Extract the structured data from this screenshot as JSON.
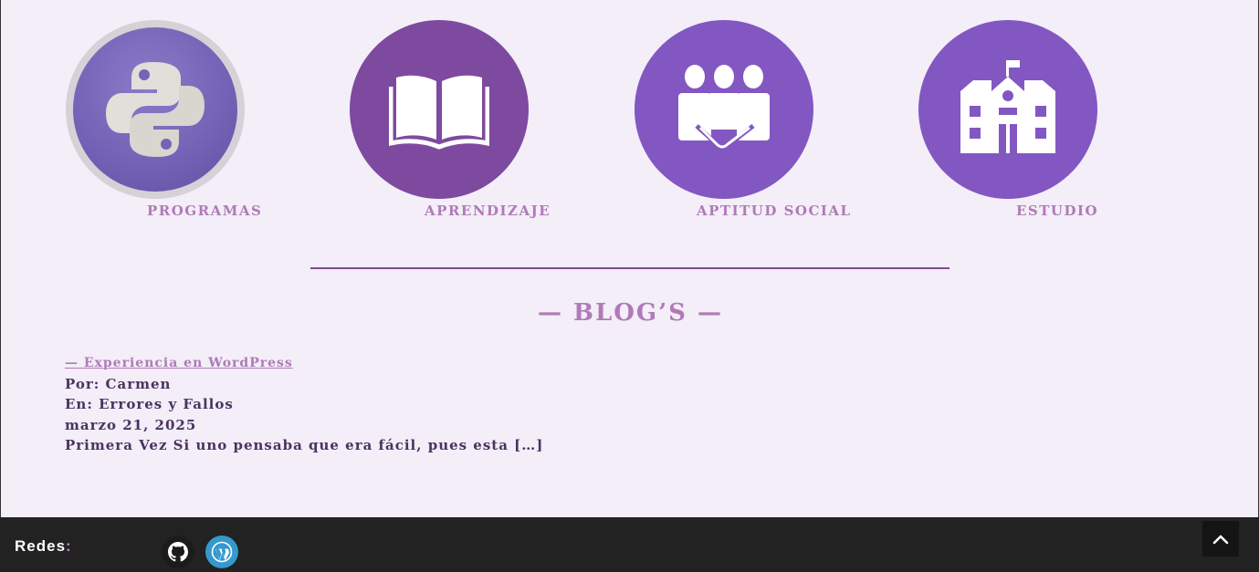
{
  "features": [
    {
      "label": "PROGRAMAS",
      "icon": "python-icon"
    },
    {
      "label": "APRENDIZAJE",
      "icon": "book-icon"
    },
    {
      "label": "APTITUD SOCIAL",
      "icon": "handshake-group-icon"
    },
    {
      "label": "ESTUDIO",
      "icon": "school-building-icon"
    }
  ],
  "blog": {
    "heading": "— BLOG’S —",
    "posts": [
      {
        "title": "— Experiencia en WordPress",
        "author": "Por: Carmen",
        "category": "En: Errores y Fallos",
        "date": "marzo 21, 2025",
        "excerpt": "Primera Vez Si uno pensaba que era fácil, pues esta […]"
      }
    ]
  },
  "footer": {
    "label": "Redes",
    "label_colon": ":",
    "social": [
      {
        "name": "github-icon",
        "color": "#1b1b1b"
      },
      {
        "name": "wordpress-icon",
        "color": "#3499cd"
      }
    ]
  },
  "colors": {
    "accent": "#b07ab8",
    "text": "#4a3360",
    "divider": "#7d4c8f",
    "footer_bg": "#222222",
    "background": "#f3eef8"
  }
}
